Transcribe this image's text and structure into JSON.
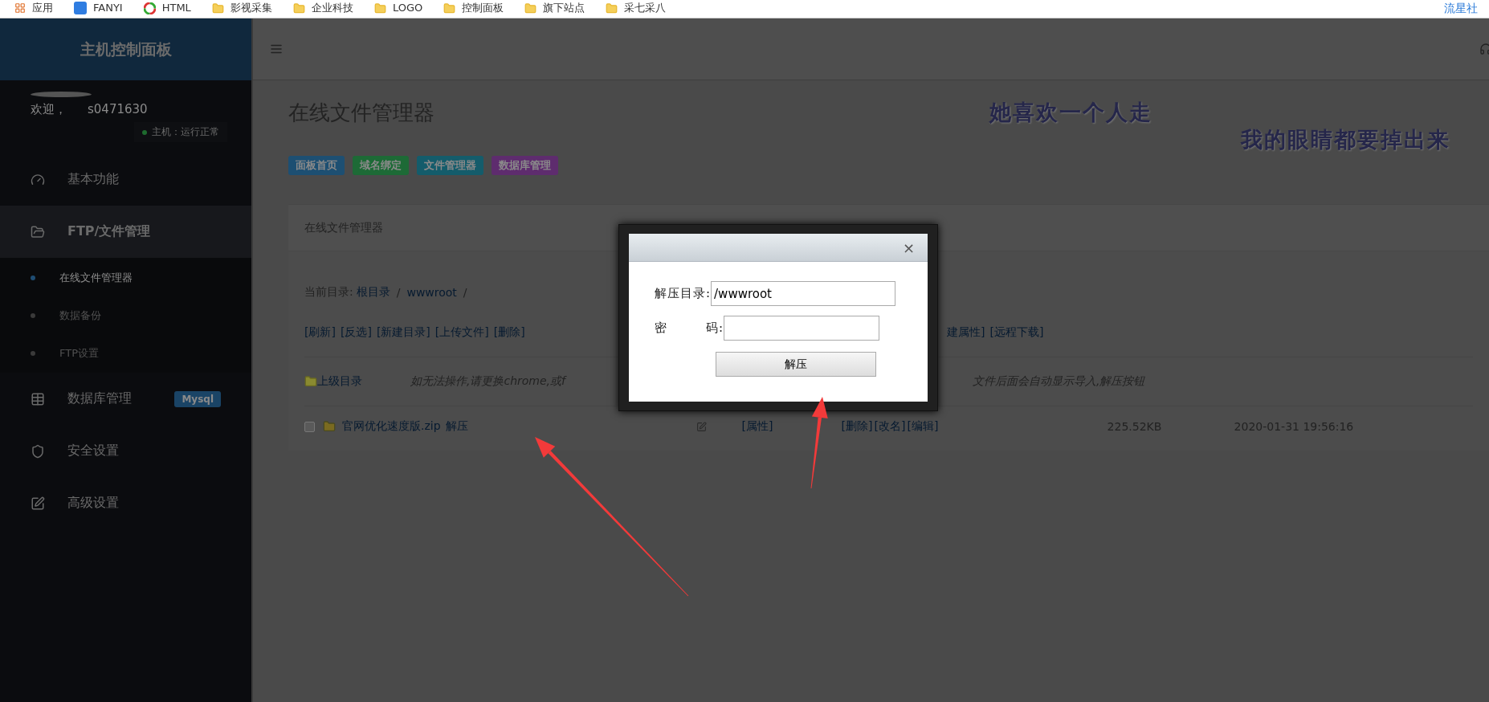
{
  "bookmarks": [
    {
      "label": "应用",
      "kind": "apps"
    },
    {
      "label": "FANYI",
      "kind": "translate"
    },
    {
      "label": "HTML",
      "kind": "wheel"
    },
    {
      "label": "影视采集",
      "kind": "folder"
    },
    {
      "label": "企业科技",
      "kind": "folder"
    },
    {
      "label": "LOGO",
      "kind": "folder"
    },
    {
      "label": "控制面板",
      "kind": "folder"
    },
    {
      "label": "旗下站点",
      "kind": "folder"
    },
    {
      "label": "采七采八",
      "kind": "folder"
    }
  ],
  "bookmark_right": "流星社",
  "sidebar": {
    "title": "主机控制面板",
    "welcome": "欢迎，",
    "username": "s0471630",
    "status": "主机：运行正常",
    "items": [
      {
        "label": "基本功能",
        "kind": "gauge",
        "selected": false
      },
      {
        "label": "FTP/文件管理",
        "kind": "folder",
        "selected": true,
        "children": [
          {
            "label": "在线文件管理器",
            "selected": true
          },
          {
            "label": "数据备份",
            "selected": false
          },
          {
            "label": "FTP设置",
            "selected": false
          }
        ]
      },
      {
        "label": "数据库管理",
        "kind": "table",
        "selected": false,
        "badge": "Mysql"
      },
      {
        "label": "安全设置",
        "kind": "shield",
        "selected": false
      },
      {
        "label": "高级设置",
        "kind": "edit",
        "selected": false
      }
    ]
  },
  "page": {
    "title": "在线文件管理器",
    "tags": [
      {
        "label": "面板首页",
        "color": "#1d4f72"
      },
      {
        "label": "域名绑定",
        "color": "#1d6a36"
      },
      {
        "label": "文件管理器",
        "color": "#145c6b"
      },
      {
        "label": "数据库管理",
        "color": "#5e2c6e"
      }
    ],
    "decor": [
      "她喜欢一个人走",
      "我的眼睛都要掉出来"
    ]
  },
  "panel": {
    "title": "在线文件管理器",
    "path_label": "当前目录:",
    "separator": "/",
    "path": [
      "根目录",
      "wwwroot"
    ],
    "actions_left": [
      "[刷新]",
      "[反选]",
      "[新建目录]",
      "[上传文件]",
      "[删除]"
    ],
    "actions_right": [
      "建属性]",
      "[远程下载]"
    ],
    "parent_link": "上级目录",
    "note_left": "如无法操作,请更换chrome,或f",
    "note_right": "文件后面会自动显示导入,解压按钮",
    "files": [
      {
        "checked": false,
        "name": "官网优化速度版.zip",
        "action": "解压",
        "links_left": [
          "[属性]"
        ],
        "links_right": [
          "[删除]",
          "[改名]",
          "[编辑]"
        ],
        "size": "225.52KB",
        "date": "2020-01-31 19:56:16"
      }
    ]
  },
  "dialog": {
    "close": "×",
    "fields": [
      {
        "label": "解压目录:",
        "value": "/wwwroot"
      },
      {
        "label": "密　　　码:"
      }
    ],
    "submit": "解压"
  }
}
